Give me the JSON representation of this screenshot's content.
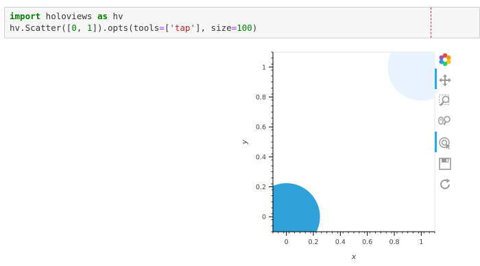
{
  "code_cell": {
    "line1": {
      "kw1": "import",
      "mid": " holoviews ",
      "kw2": "as",
      "end": " hv"
    },
    "line2": {
      "p1": "hv.Scatter([",
      "n1": "0",
      ", ": ", ",
      "n2": "1",
      "p2": "]).opts(tools",
      "eq1": "=",
      "p3": "[",
      "s1": "'tap'",
      "p4": "], size",
      "eq2": "=",
      "n3": "100",
      "p5": ")"
    }
  },
  "toolbar": {
    "tools": [
      {
        "name": "bokeh-logo-icon",
        "active": false
      },
      {
        "name": "pan-tool-icon",
        "active": true
      },
      {
        "name": "box-zoom-tool-icon",
        "active": false
      },
      {
        "name": "wheel-zoom-tool-icon",
        "active": false
      },
      {
        "name": "tap-tool-icon",
        "active": true
      },
      {
        "name": "save-tool-icon",
        "active": false
      },
      {
        "name": "reset-tool-icon",
        "active": false
      }
    ]
  },
  "chart_data": {
    "type": "scatter",
    "x": [
      0,
      1
    ],
    "y": [
      0,
      1
    ],
    "xlabel": "x",
    "ylabel": "y",
    "xlim": [
      -0.1,
      1.1
    ],
    "ylim": [
      -0.1,
      1.1
    ],
    "x_ticks": [
      "0",
      "0.2",
      "0.4",
      "0.6",
      "0.8",
      "1"
    ],
    "y_ticks": [
      "0",
      "0.2",
      "0.4",
      "0.6",
      "0.8",
      "1"
    ],
    "selected_index": 0,
    "colors": {
      "selected": "#30a2da",
      "unselected": "#e8f4fb"
    }
  }
}
